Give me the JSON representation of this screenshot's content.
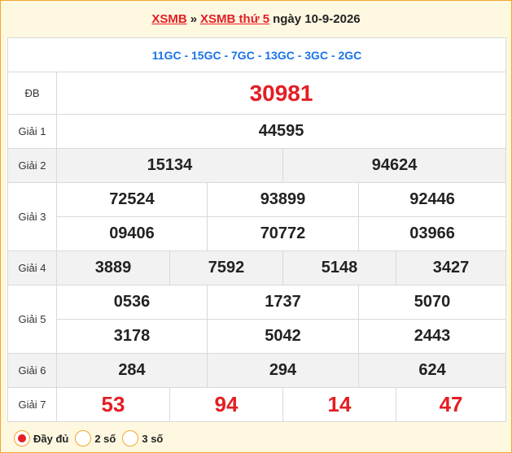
{
  "header": {
    "link1": "XSMB",
    "sep": "»",
    "link2": "XSMB thứ 5",
    "date": "ngày 10-9-2026"
  },
  "codes": "11GC - 15GC - 7GC - 13GC - 3GC - 2GC",
  "prizes": {
    "db": {
      "label": "ĐB",
      "values": [
        "30981"
      ]
    },
    "g1": {
      "label": "Giải 1",
      "values": [
        "44595"
      ]
    },
    "g2": {
      "label": "Giải 2",
      "values": [
        "15134",
        "94624"
      ]
    },
    "g3": {
      "label": "Giải 3",
      "values": [
        "72524",
        "93899",
        "92446",
        "09406",
        "70772",
        "03966"
      ]
    },
    "g4": {
      "label": "Giải 4",
      "values": [
        "3889",
        "7592",
        "5148",
        "3427"
      ]
    },
    "g5": {
      "label": "Giải 5",
      "values": [
        "0536",
        "1737",
        "5070",
        "3178",
        "5042",
        "2443"
      ]
    },
    "g6": {
      "label": "Giải 6",
      "values": [
        "284",
        "294",
        "624"
      ]
    },
    "g7": {
      "label": "Giải 7",
      "values": [
        "53",
        "94",
        "14",
        "47"
      ]
    }
  },
  "footer": {
    "options": [
      {
        "label": "Đầy đủ",
        "selected": true
      },
      {
        "label": "2 số",
        "selected": false
      },
      {
        "label": "3 số",
        "selected": false
      }
    ]
  },
  "colors": {
    "accent_red": "#e31e24",
    "code_blue": "#1a73e8",
    "border_orange": "#f4a52c"
  }
}
